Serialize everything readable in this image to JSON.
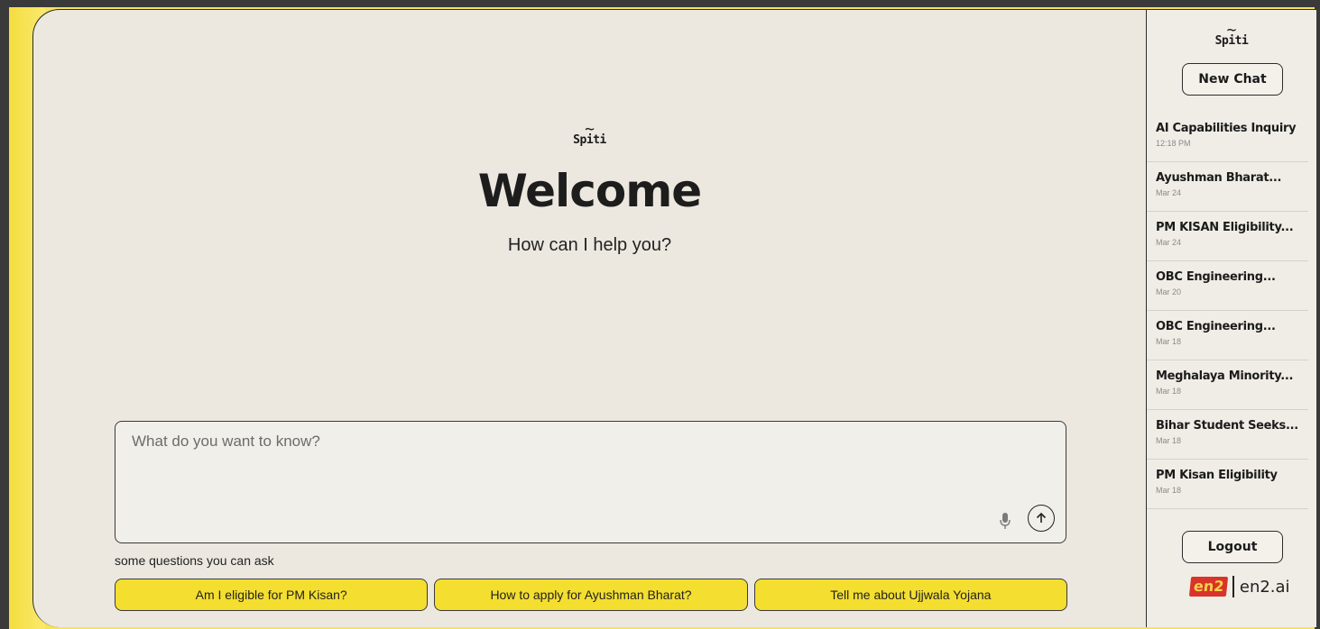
{
  "brand": {
    "name": "Spiti",
    "tilde": "~"
  },
  "hero": {
    "title": "Welcome",
    "subtitle": "How can I help you?"
  },
  "composer": {
    "placeholder": "What do you want to know?"
  },
  "suggestions": {
    "hint": "some questions you can ask",
    "items": [
      {
        "label": "Am I eligible for PM Kisan?"
      },
      {
        "label": "How to apply for Ayushman Bharat?"
      },
      {
        "label": "Tell me about Ujjwala Yojana"
      }
    ]
  },
  "sidebar": {
    "new_chat_label": "New Chat",
    "chats": [
      {
        "title": "AI Capabilities Inquiry",
        "date": "12:18 PM"
      },
      {
        "title": "Ayushman Bharat...",
        "date": "Mar 24"
      },
      {
        "title": "PM KISAN Eligibility...",
        "date": "Mar 24"
      },
      {
        "title": "OBC Engineering...",
        "date": "Mar 20"
      },
      {
        "title": "OBC Engineering...",
        "date": "Mar 18"
      },
      {
        "title": "Meghalaya Minority...",
        "date": "Mar 18"
      },
      {
        "title": "Bihar Student Seeks...",
        "date": "Mar 18"
      },
      {
        "title": "PM Kisan Eligibility",
        "date": "Mar 18"
      }
    ],
    "logout_label": "Logout",
    "footer": {
      "mark": "en2",
      "text": "en2.ai"
    }
  },
  "colors": {
    "accent_yellow": "#f4de30",
    "background": "#ece8e0",
    "sidebar_bg": "#efede6",
    "text": "#1d1d1d"
  }
}
